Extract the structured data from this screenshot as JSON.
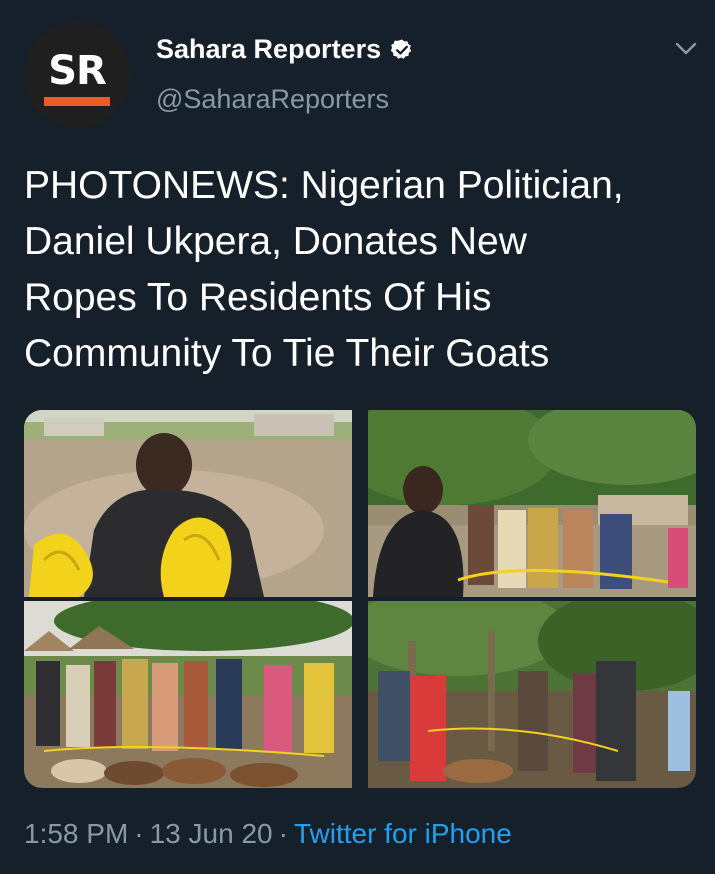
{
  "account": {
    "avatar_text": "SR",
    "display_name": "Sahara Reporters",
    "handle": "@SaharaReporters",
    "verified": true,
    "verified_icon": "verified-badge-icon",
    "brand_color": "#f05a28"
  },
  "tweet": {
    "text": "PHOTONEWS: Nigerian Politician,\nDaniel Ukpera, Donates New\nRopes To Residents Of His\nCommunity To Tie Their Goats",
    "time": "1:58 PM",
    "date": "13 Jun 20",
    "source": "Twitter for iPhone",
    "link_color": "#1da1f2"
  },
  "media": {
    "count": 4,
    "photos": [
      "man-with-yellow-ropes",
      "group-under-tree",
      "villagers-with-goats",
      "ropes-tied-to-goats"
    ]
  },
  "menu_icon": "chevron-down-icon"
}
